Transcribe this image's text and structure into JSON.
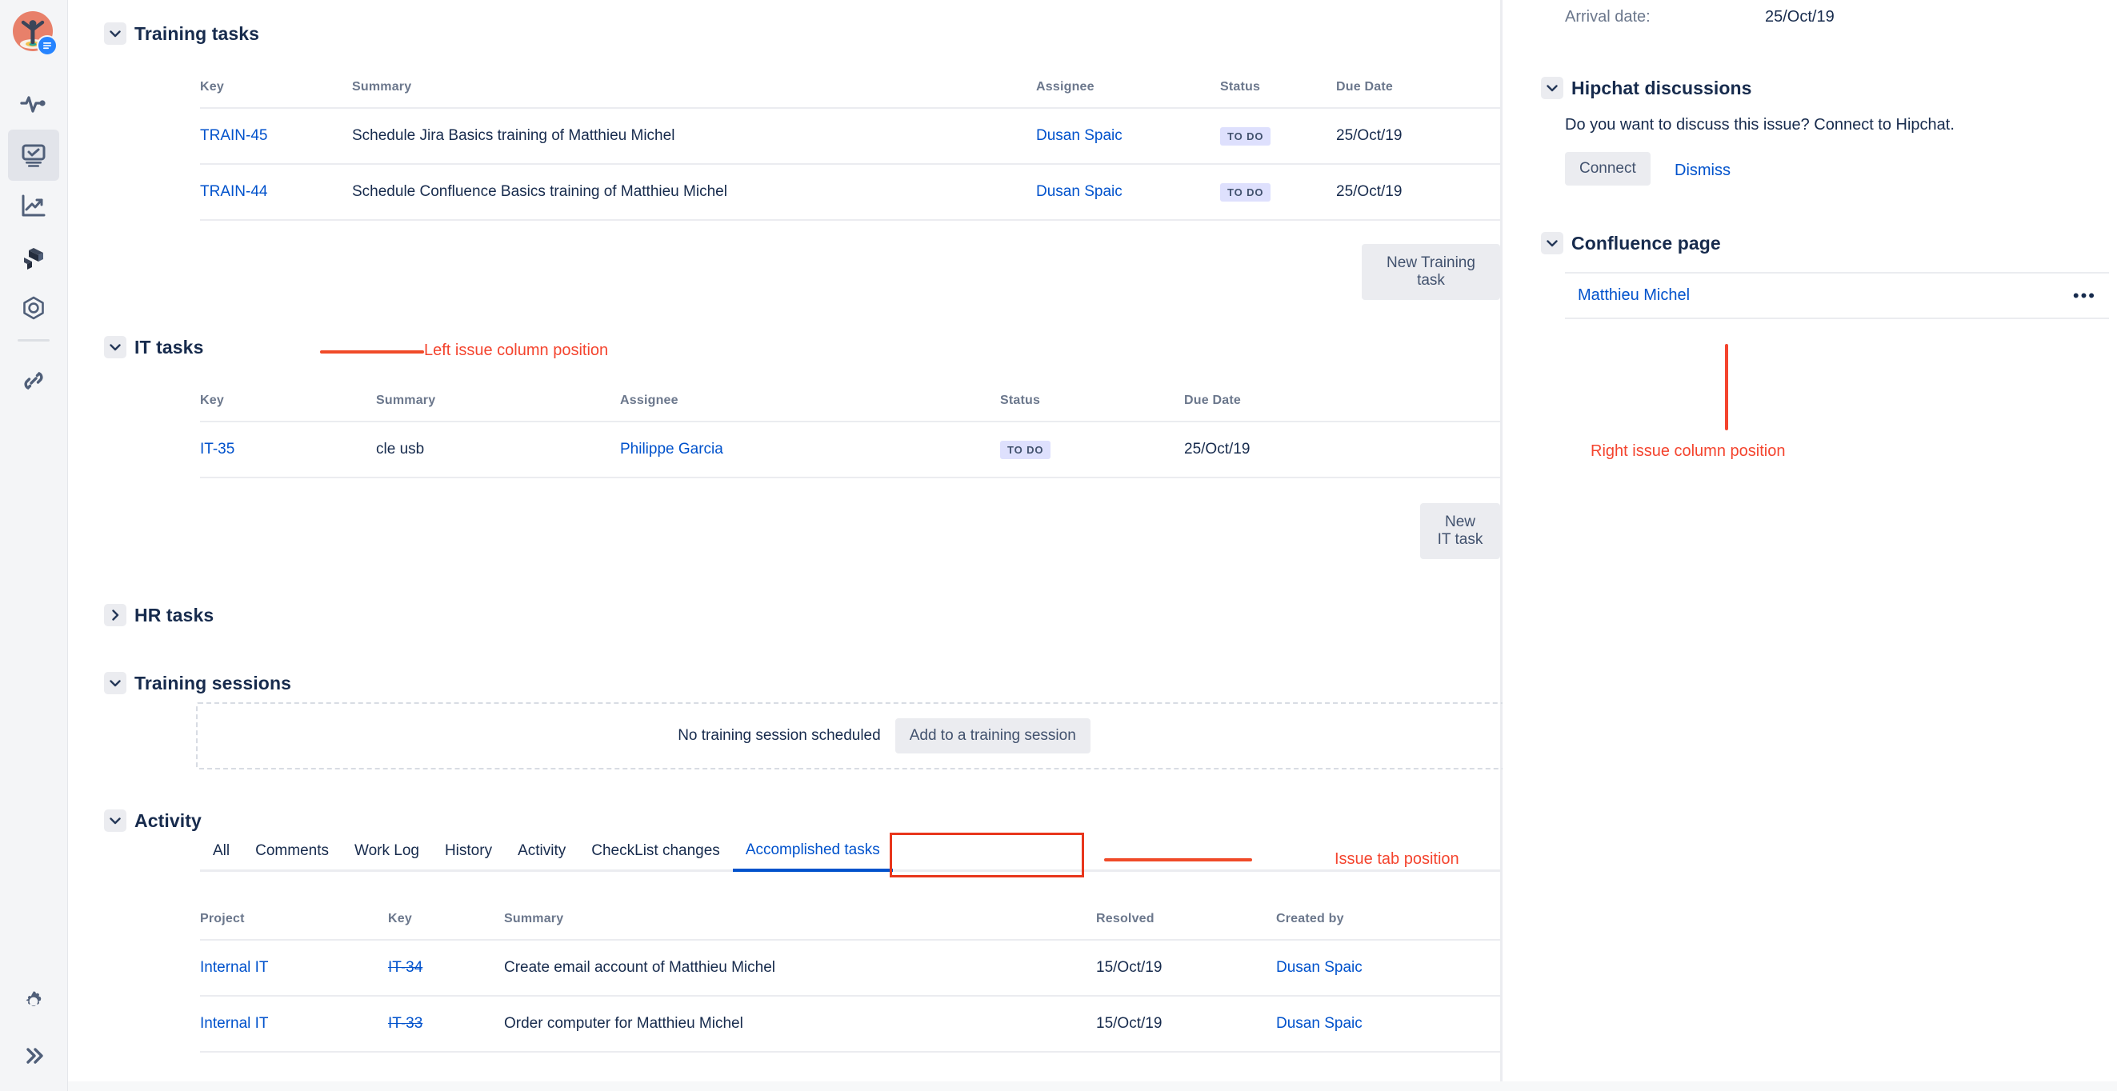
{
  "rail": {
    "items": [
      {
        "name": "avatar",
        "label": "User avatar"
      },
      {
        "name": "pulse-icon",
        "label": "Pulse"
      },
      {
        "name": "board-icon",
        "label": "Board"
      },
      {
        "name": "chart-icon",
        "label": "Reports"
      },
      {
        "name": "workflow-icon",
        "label": "Workflow"
      },
      {
        "name": "target-icon",
        "label": "Goals"
      },
      {
        "name": "link-icon",
        "label": "Links"
      }
    ],
    "bottom": [
      {
        "name": "gear-icon",
        "label": "Settings"
      },
      {
        "name": "double-chevron-right-icon",
        "label": "Expand sidebar"
      }
    ]
  },
  "training_tasks": {
    "title": "Training tasks",
    "columns": [
      "Key",
      "Summary",
      "Assignee",
      "Status",
      "Due Date"
    ],
    "rows": [
      {
        "key": "TRAIN-45",
        "summary": "Schedule Jira Basics training of Matthieu Michel",
        "assignee": "Dusan Spaic",
        "status": "TO DO",
        "due": "25/Oct/19",
        "menu": "•••"
      },
      {
        "key": "TRAIN-44",
        "summary": "Schedule Confluence Basics training of Matthieu Michel",
        "assignee": "Dusan Spaic",
        "status": "TO DO",
        "due": "25/Oct/19",
        "menu": "•••"
      }
    ],
    "new_button": "New Training task"
  },
  "it_tasks": {
    "title": "IT tasks",
    "columns": [
      "Key",
      "Summary",
      "Assignee",
      "Status",
      "Due Date"
    ],
    "rows": [
      {
        "key": "IT-35",
        "summary": "cle usb",
        "assignee": "Philippe Garcia",
        "status": "TO DO",
        "due": "25/Oct/19",
        "menu": "•••"
      }
    ],
    "new_button": "New IT task"
  },
  "hr_tasks": {
    "title": "HR tasks"
  },
  "training_sessions": {
    "title": "Training sessions",
    "empty_text": "No training session scheduled",
    "add_button": "Add to a training session"
  },
  "activity": {
    "title": "Activity",
    "tabs": [
      {
        "label": "All",
        "active": false
      },
      {
        "label": "Comments",
        "active": false
      },
      {
        "label": "Work Log",
        "active": false
      },
      {
        "label": "History",
        "active": false
      },
      {
        "label": "Activity",
        "active": false
      },
      {
        "label": "CheckList changes",
        "active": false
      },
      {
        "label": "Accomplished tasks",
        "active": true
      }
    ],
    "columns": [
      "Project",
      "Key",
      "Summary",
      "Resolved",
      "Created by"
    ],
    "rows": [
      {
        "project": "Internal IT",
        "key": "IT-34",
        "summary": "Create email account of Matthieu Michel",
        "resolved": "15/Oct/19",
        "created_by": "Dusan Spaic",
        "menu": "•••"
      },
      {
        "project": "Internal IT",
        "key": "IT-33",
        "summary": "Order computer for Matthieu Michel",
        "resolved": "15/Oct/19",
        "created_by": "Dusan Spaic",
        "menu": "•••"
      }
    ]
  },
  "right_panel": {
    "arrival_label": "Arrival date:",
    "arrival_value": "25/Oct/19",
    "hipchat": {
      "title": "Hipchat discussions",
      "body": "Do you want to discuss this issue? Connect to Hipchat.",
      "connect": "Connect",
      "dismiss": "Dismiss"
    },
    "confluence": {
      "title": "Confluence page",
      "page": "Matthieu Michel",
      "menu": "•••"
    }
  },
  "annotations": {
    "left_column": "Left issue column position",
    "right_column": "Right issue column position",
    "issue_tab": "Issue tab position",
    "color": "#F4442E"
  }
}
